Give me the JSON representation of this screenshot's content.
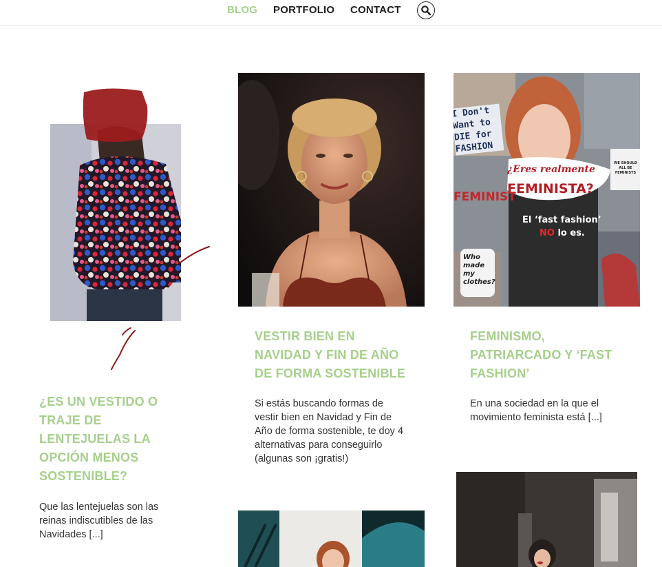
{
  "nav": {
    "items": [
      {
        "label": "BLOG",
        "active": true
      },
      {
        "label": "PORTFOLIO",
        "active": false
      },
      {
        "label": "CONTACT",
        "active": false
      }
    ],
    "search_icon": "search-icon"
  },
  "colors": {
    "accent": "#a6d08c",
    "brush_red": "#9b1c1c",
    "text": "#333333"
  },
  "posts": [
    {
      "title": "¿ES UN VESTIDO O TRAJE DE LENTEJUELAS LA OPCIÓN MENOS SOSTENIBLE?",
      "excerpt": "Que las lentejuelas son las reinas indiscutibles de las Navidades [...]"
    },
    {
      "title": "VESTIR BIEN EN NAVIDAD Y FIN DE AÑO DE FORMA SOSTENIBLE",
      "excerpt": "Si estás buscando formas de vestir bien en Navidad y Fin de Año de forma sostenible, te doy 4 alternativas para conseguirlo (algunas son ¡gratis!)"
    },
    {
      "title": "FEMINISMO, PATRIARCADO Y ‘FAST FASHION’",
      "excerpt": "En una sociedad en la que el movimiento feminista está [...]",
      "image_text": {
        "sign": "I Don't Want to DIE for FASHION",
        "question_1": "¿Eres realmente",
        "question_2": "FEMINISTA?",
        "side": "FEMINIST",
        "line_1": "El ‘fast fashion’",
        "line_2_bold": "NO",
        "line_2_rest": "lo es.",
        "mug": "Who made my clothes?",
        "tee": "WE SHOULD ALL BE FEMINISTS"
      }
    }
  ]
}
